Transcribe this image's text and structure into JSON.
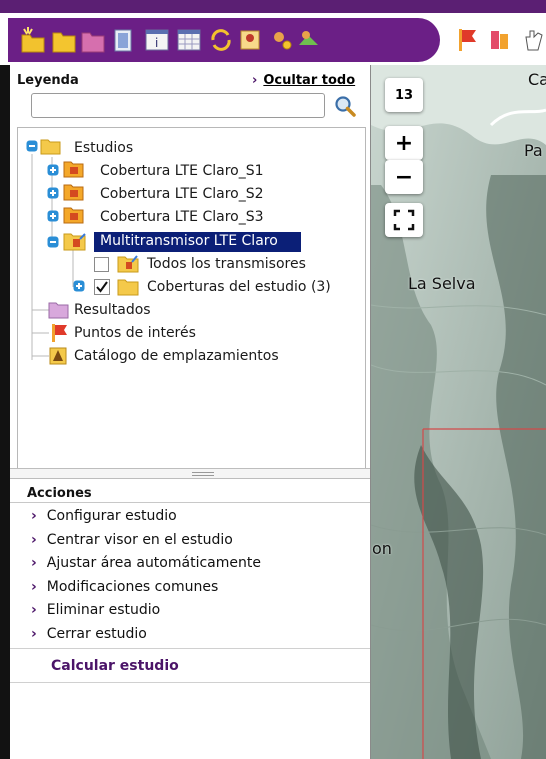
{
  "legend": {
    "title": "Leyenda",
    "hide_all": "Ocultar todo",
    "search_placeholder": ""
  },
  "tree": {
    "root": "Estudios",
    "items": [
      "Cobertura LTE Claro_S1",
      "Cobertura LTE Claro_S2",
      "Cobertura LTE Claro_S3",
      "Multitransmisor LTE Claro"
    ],
    "children": [
      "Todos los transmisores",
      "Coberturas del estudio (3)"
    ],
    "others": [
      "Resultados",
      "Puntos de interés",
      "Catálogo de emplazamientos"
    ]
  },
  "actions": {
    "title": "Acciones",
    "items": [
      "Configurar estudio",
      "Centrar visor en el estudio",
      "Ajustar área automáticamente",
      "Modificaciones comunes",
      "Eliminar estudio",
      "Cerrar estudio"
    ],
    "calculate": "Calcular estudio"
  },
  "map": {
    "zoom_level": "13",
    "zoom_in": "+",
    "zoom_out": "−",
    "labels": [
      "La Selva",
      "Pa",
      "Ca",
      "on"
    ]
  },
  "colors": {
    "brand_purple": "#6b1f86",
    "selection": "#0b1f77",
    "link": "#4b1468"
  }
}
